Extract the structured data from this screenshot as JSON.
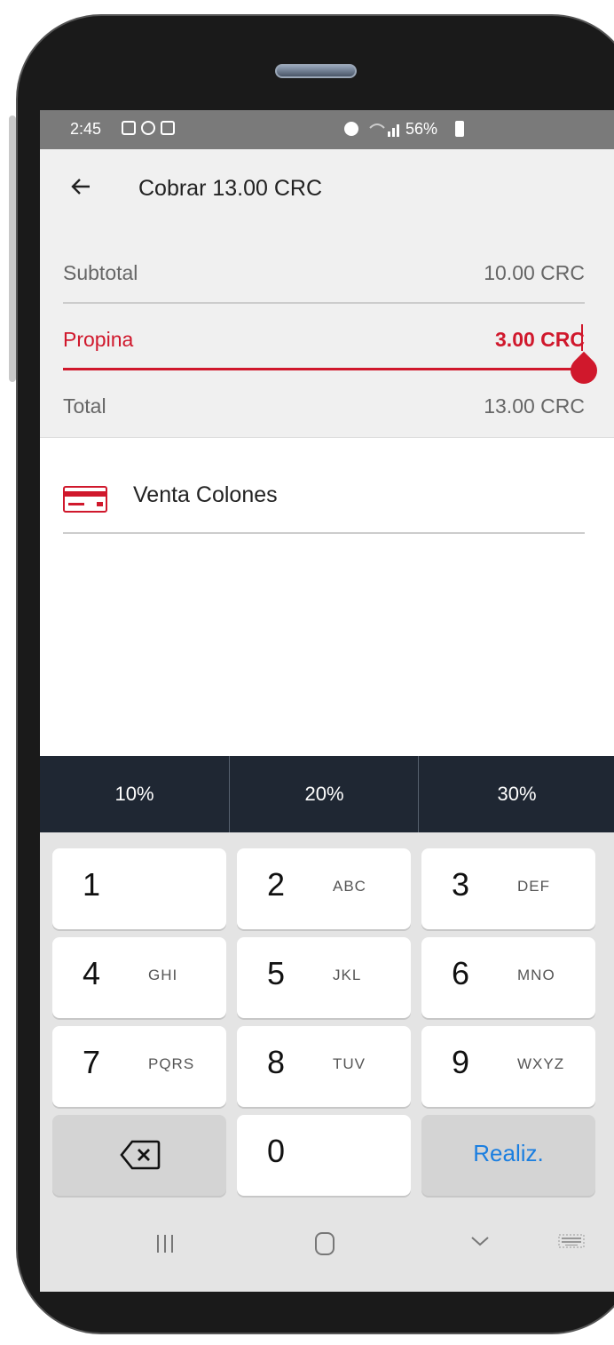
{
  "status": {
    "time": "2:45",
    "battery_pct": "56%"
  },
  "header": {
    "title": "Cobrar 13.00 CRC"
  },
  "summary": {
    "subtotal_label": "Subtotal",
    "subtotal_value": "10.00 CRC",
    "tip_label": "Propina",
    "tip_value": "3.00 CRC",
    "total_label": "Total",
    "total_value": "13.00 CRC"
  },
  "payment": {
    "method_label": "Venta Colones",
    "icon": "credit-card-icon"
  },
  "tip_options": [
    "10%",
    "20%",
    "30%"
  ],
  "keypad": {
    "keys": [
      {
        "num": "1",
        "letters": ""
      },
      {
        "num": "2",
        "letters": "ABC"
      },
      {
        "num": "3",
        "letters": "DEF"
      },
      {
        "num": "4",
        "letters": "GHI"
      },
      {
        "num": "5",
        "letters": "JKL"
      },
      {
        "num": "6",
        "letters": "MNO"
      },
      {
        "num": "7",
        "letters": "PQRS"
      },
      {
        "num": "8",
        "letters": "TUV"
      },
      {
        "num": "9",
        "letters": "WXYZ"
      },
      {
        "num": "0",
        "letters": ""
      }
    ],
    "done_label": "Realiz."
  },
  "colors": {
    "accent": "#d0182c",
    "keypad_bg": "#e4e4e4",
    "pct_bar": "#1f2733",
    "done_blue": "#1a7ee0"
  }
}
